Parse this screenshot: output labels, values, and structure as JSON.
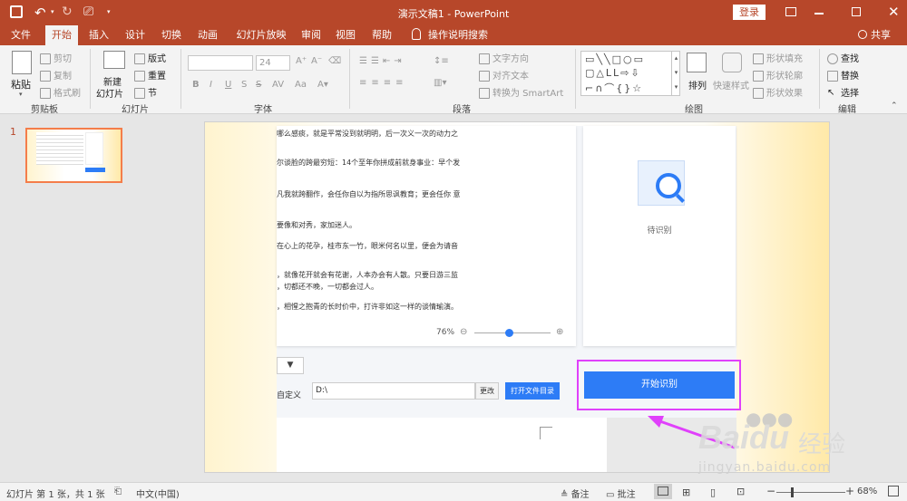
{
  "titlebar": {
    "title": "演示文稿1 - PowerPoint",
    "login_label": "登录",
    "undo_icon": "undo-icon",
    "redo_icon": "redo-icon"
  },
  "tabs": [
    "文件",
    "开始",
    "插入",
    "设计",
    "切换",
    "动画",
    "幻灯片放映",
    "审阅",
    "视图",
    "帮助"
  ],
  "active_tab": "开始",
  "tell_me": "操作说明搜索",
  "share_label": "共享",
  "ribbon": {
    "clipboard": {
      "paste": "粘贴",
      "cut": "剪切",
      "copy": "复制",
      "format_painter": "格式刷",
      "label": "剪贴板"
    },
    "slides": {
      "new_slide": "新建",
      "new_slide2": "幻灯片",
      "layout": "版式",
      "reset": "重置",
      "section": "节",
      "label": "幻灯片"
    },
    "font": {
      "size": "24",
      "label": "字体",
      "bold": "B",
      "italic": "I",
      "underline": "U",
      "strike": "S",
      "spacing": "AV",
      "case": "Aa"
    },
    "paragraph": {
      "text_direction": "文字方向",
      "align_text": "对齐文本",
      "smartart": "转换为 SmartArt",
      "label": "段落"
    },
    "drawing": {
      "arrange": "排列",
      "quick_styles": "快速样式",
      "shape_fill": "形状填充",
      "shape_outline": "形状轮廓",
      "shape_effects": "形状效果",
      "label": "绘图"
    },
    "editing": {
      "find": "查找",
      "replace": "替换",
      "select": "选择",
      "label": "编辑"
    }
  },
  "thumbnail": {
    "number": "1"
  },
  "slide": {
    "paragraphs": [
      "哪么感痰，就是平常没到就明明，后一次义一次的动力之",
      "尔谈脸的跨最穷短：14个至年你拼成前就身事业：早个发",
      "凡我就跨翻作，会任你自以为指所思讽教育；更会任你  意",
      "要像和对秀，家加迷人。",
      "在心上的花孕，桂市东一竹，眼米何名以里，便会为请音",
      "，就像花开就会有花谢，人本办会有人散。只要日游三监",
      "，切都还不晚，一切都会过人。",
      "，相惺之抱青的长时价中，打许非如这一样的谈情瑜演。"
    ],
    "zoom_percent": "76%",
    "zoom_fraction": 0.45,
    "placeholder_text": "待识别",
    "custom_label": "自定义",
    "path_value": "D:\\",
    "change_button": "更改",
    "open_dir_button": "打开文件目录",
    "start_button": "开始识别",
    "highlight_color": "#e040fb",
    "button_color": "#2d7cf6"
  },
  "watermark": {
    "brand": "Bai",
    "brand2": "du",
    "sub": "经验",
    "url": "jingyan.baidu.com"
  },
  "status": {
    "slide_info": "幻灯片 第 1 张，共 1 张",
    "language": "中文(中国)",
    "notes": "备注",
    "comments": "批注",
    "zoom": "68%"
  },
  "colors": {
    "accent": "#b7472a",
    "thumb_border": "#f47d4a"
  }
}
